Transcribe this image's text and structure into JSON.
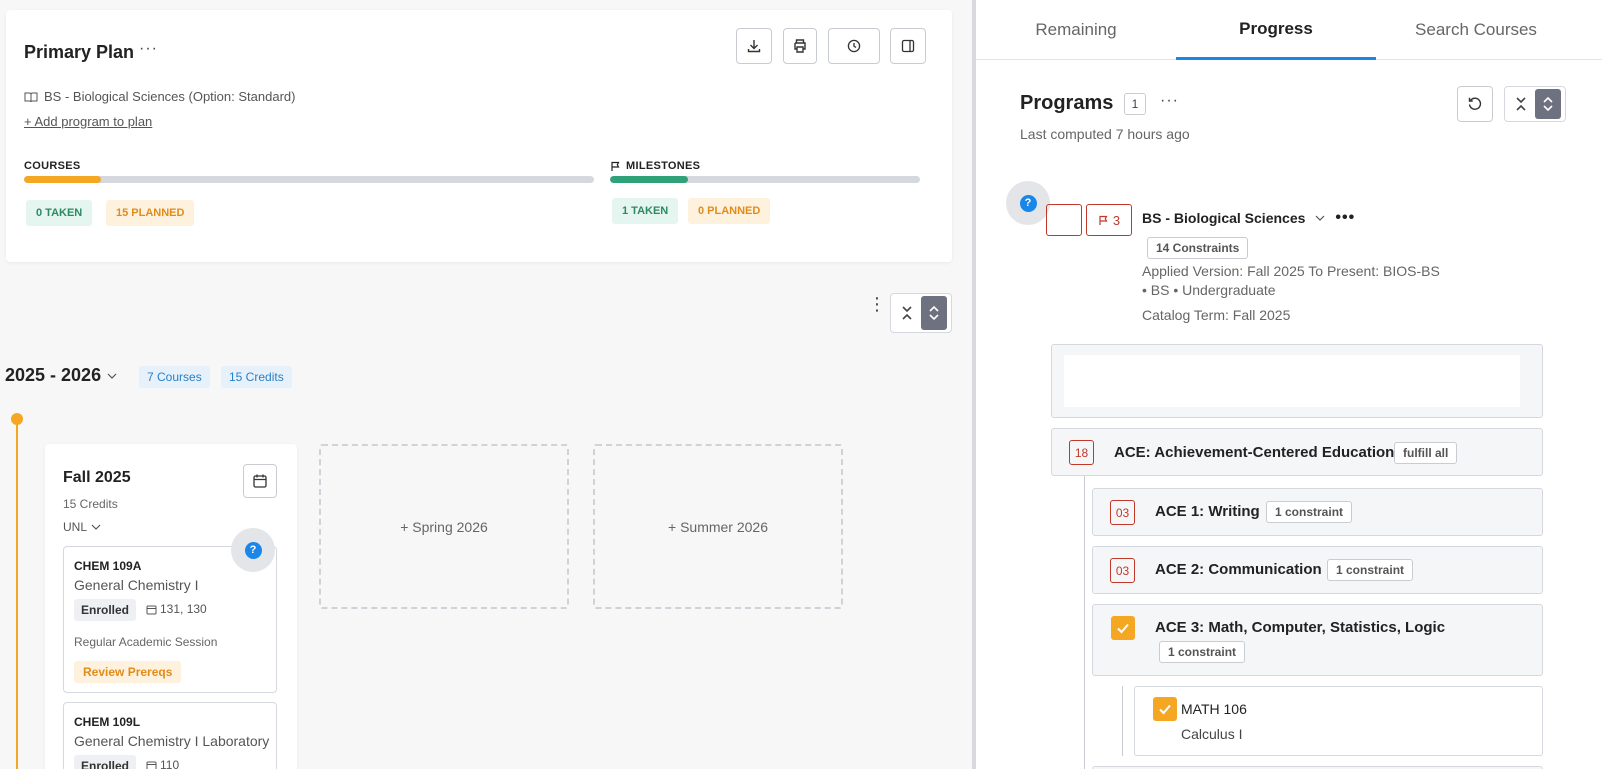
{
  "plan": {
    "title": "Primary Plan",
    "more": "···",
    "program": "BS - Biological Sciences (Option: Standard)",
    "add_program": "+ Add program to plan",
    "courses_label": "COURSES",
    "courses_progress": 0.135,
    "courses_taken": "0 TAKEN",
    "courses_planned": "15 PLANNED",
    "milestones_label": "MILESTONES",
    "milestones_progress": 0.25,
    "milestones_taken": "1 TAKEN",
    "milestones_planned": "0 PLANNED"
  },
  "year": {
    "title": "2025 - 2026",
    "courses": "7 Courses",
    "credits": "15 Credits"
  },
  "term": {
    "title": "Fall 2025",
    "credits": "15 Credits",
    "school": "UNL",
    "courses": [
      {
        "code": "CHEM 109A",
        "name": "General Chemistry I",
        "status": "Enrolled",
        "room": "131, 130",
        "session": "Regular Academic Session",
        "action": "Review Prereqs"
      },
      {
        "code": "CHEM 109L",
        "name": "General Chemistry I Laboratory",
        "status": "Enrolled",
        "room": "110"
      }
    ]
  },
  "empty_terms": [
    "+ Spring 2026",
    "+ Summer 2026"
  ],
  "tabs": [
    "Remaining",
    "Progress",
    "Search Courses"
  ],
  "programs": {
    "title": "Programs",
    "count": "1",
    "more": "···",
    "computed": "Last computed 7 hours ago",
    "name": "BS - Biological Sciences",
    "flag_count": "3",
    "constraints": "14 Constraints",
    "version": "Applied Version: Fall 2025 To Present: BIOS-BS • BS • Undergraduate",
    "catalog": "Catalog Term: Fall 2025"
  },
  "requirements": [
    {
      "num": "18",
      "title": "ACE: Achievement-Centered Education",
      "pill": "fulfill all"
    },
    {
      "num": "03",
      "title": "ACE 1: Writing",
      "pill": "1 constraint"
    },
    {
      "num": "03",
      "title": "ACE 2: Communication",
      "pill": "1 constraint"
    },
    {
      "num": "",
      "title": "ACE 3: Math, Computer, Statistics, Logic",
      "pill": "1 constraint"
    }
  ],
  "course_req": {
    "code": "MATH 106",
    "name": "Calculus I"
  },
  "help": "?",
  "colors": {
    "accent": "#1a86e8",
    "orange": "#f5a623",
    "green": "#2fa27a",
    "red": "#c0392b"
  }
}
